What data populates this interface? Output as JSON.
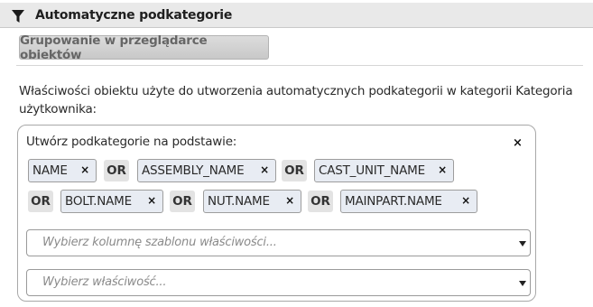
{
  "header": {
    "title": "Automatyczne podkategorie"
  },
  "group_button": {
    "label": "Grupowanie w przeglądarce obiektów"
  },
  "description": "Właściwości obiektu użyte do utworzenia automatycznych podkategorii w kategorii Kategoria użytkownika:",
  "panel": {
    "label": "Utwórz podkategorie na podstawie:",
    "close": "×",
    "chips": [
      {
        "label": "NAME",
        "remove": "×"
      },
      {
        "label": "ASSEMBLY_NAME",
        "remove": "×"
      },
      {
        "label": "CAST_UNIT_NAME",
        "remove": "×"
      },
      {
        "label": "BOLT.NAME",
        "remove": "×"
      },
      {
        "label": "NUT.NAME",
        "remove": "×"
      },
      {
        "label": "MAINPART.NAME",
        "remove": "×"
      }
    ],
    "operator": "OR",
    "template_select": {
      "placeholder": "Wybierz kolumnę szablonu właściwości..."
    },
    "property_select": {
      "placeholder": "Wybierz właściwość..."
    }
  }
}
